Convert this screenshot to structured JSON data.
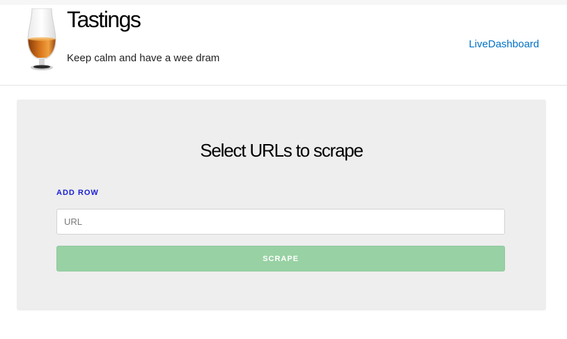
{
  "header": {
    "title": "Tastings",
    "tagline": "Keep calm and have a wee dram",
    "nav_link": "LiveDashboard",
    "logo_icon": "whisky-glass-icon"
  },
  "main": {
    "heading": "Select URLs to scrape",
    "add_row_label": "ADD ROW",
    "url_placeholder": "URL",
    "url_value": "",
    "scrape_label": "SCRAPE"
  },
  "colors": {
    "link": "#0071c6",
    "add_row": "#1a20d6",
    "scrape_button": "#98d1a3",
    "card_background": "#eeeeee"
  }
}
